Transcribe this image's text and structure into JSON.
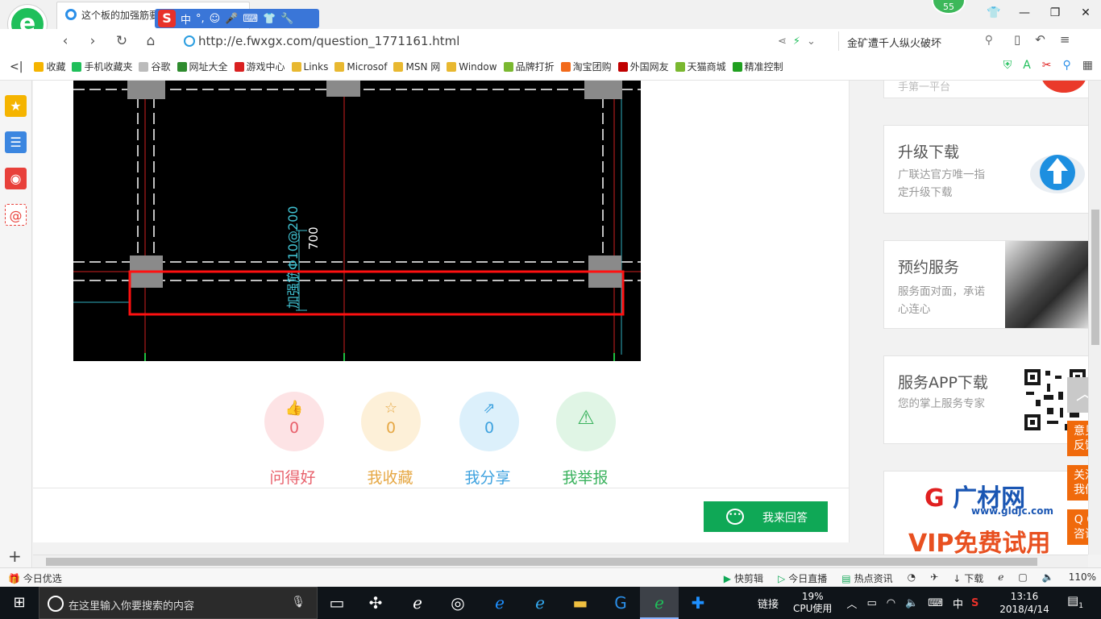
{
  "browser": {
    "tab_title": "这个板的加强筋要怎么画_广联达",
    "url_host": "http://e.fwxgx.com",
    "url_path": "/question_1771161.html",
    "search_text": "金矿遭千人纵火破坏",
    "badge_count": "55",
    "ime_glyphs": [
      "中",
      "°,",
      "☺",
      "🎤",
      "⌨",
      "👕",
      "🔧"
    ]
  },
  "bookmarks": [
    {
      "label": "收藏",
      "color": "#f5b400"
    },
    {
      "label": "手机收藏夹",
      "color": "#1fbf5a"
    },
    {
      "label": "谷歌",
      "color": "#bbbbbb"
    },
    {
      "label": "网址大全",
      "color": "#2e8b2e"
    },
    {
      "label": "游戏中心",
      "color": "#d92020"
    },
    {
      "label": "Links",
      "color": "#e8b830"
    },
    {
      "label": "Microsof",
      "color": "#e8b830"
    },
    {
      "label": "MSN 网",
      "color": "#e8b830"
    },
    {
      "label": "Window",
      "color": "#e8b830"
    },
    {
      "label": "品牌打折",
      "color": "#7ab830"
    },
    {
      "label": "淘宝团购",
      "color": "#f26a1b"
    },
    {
      "label": "外国网友",
      "color": "#c00000"
    },
    {
      "label": "天猫商城",
      "color": "#7ab830"
    },
    {
      "label": "精准控制",
      "color": "#20a020"
    }
  ],
  "drawing": {
    "dim_label": "700",
    "rebar_label": "加强筋Φ10@200"
  },
  "actions": [
    {
      "count": "0",
      "label": "问得好",
      "icon": "thumbs-up-icon",
      "glyph": "👍",
      "bg": "#fde3e5",
      "fg": "#e8606b"
    },
    {
      "count": "0",
      "label": "我收藏",
      "icon": "star-icon",
      "glyph": "☆",
      "bg": "#fdf0d8",
      "fg": "#e6a845"
    },
    {
      "count": "0",
      "label": "我分享",
      "icon": "share-icon",
      "glyph": "⇗",
      "bg": "#dcf0fb",
      "fg": "#3ea2df"
    },
    {
      "count": "",
      "label": "我举报",
      "icon": "warning-icon",
      "glyph": "⚠",
      "bg": "#e0f5e5",
      "fg": "#3ab25d"
    }
  ],
  "answer_button": "我来回答",
  "side_cards": {
    "upgrade": {
      "title": "升级下载",
      "desc": "广联达官方唯一指定升级下载"
    },
    "book": {
      "title": "预约服务",
      "desc": "服务面对面，承诺心连心"
    },
    "app": {
      "title": "服务APP下载",
      "desc": "您的掌上服务专家"
    },
    "glodon": {
      "logo_g": "G",
      "logo_text": "广材网",
      "site": "www.gldjc.com",
      "promo": "VIP免费试用"
    },
    "partial_text": "手第一平台"
  },
  "float_buttons": {
    "top": "︿",
    "feedback": [
      "意见",
      "反馈"
    ],
    "follow": [
      "关注",
      "我们"
    ],
    "qq": [
      "Q Q",
      "咨询"
    ]
  },
  "statusbar": {
    "left": "今日优选",
    "items": [
      "快剪辑",
      "今日直播",
      "热点资讯",
      "下载",
      "110%"
    ]
  },
  "taskbar": {
    "search_placeholder": "在这里输入你要搜索的内容",
    "tray_link": "链接",
    "cpu_pct": "19%",
    "cpu_label": "CPU使用",
    "ime": "中",
    "time": "13:16",
    "date": "2018/4/14",
    "notif_count": "1"
  }
}
